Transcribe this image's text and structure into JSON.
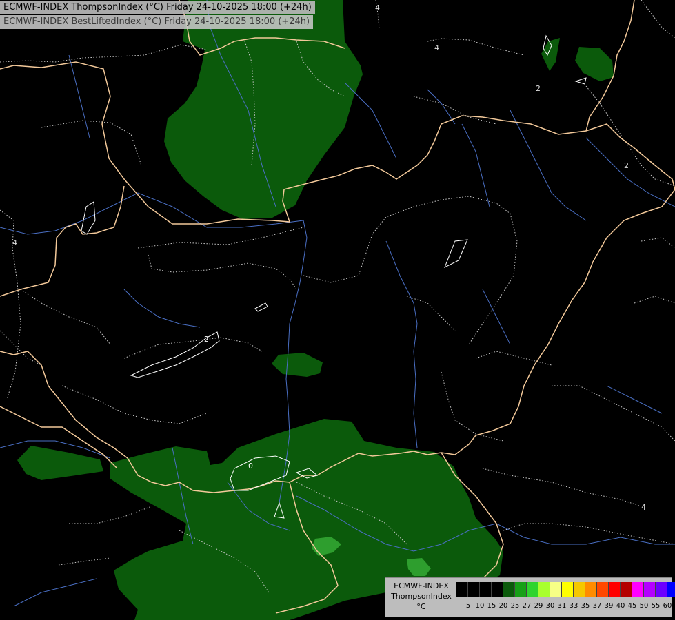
{
  "header": {
    "title_primary": "ECMWF-INDEX ThompsonIndex (°C) Friday 24-10-2025 18:00 (+24h)",
    "title_secondary": "ECMWF-INDEX BestLiftedIndex (°C) Friday 24-10-2025 18:00 (+24h)"
  },
  "map": {
    "contour_labels": [
      "4",
      "4",
      "2",
      "2",
      "4",
      "2",
      "0",
      "4"
    ],
    "colors": {
      "background": "#000000",
      "fill_low": "#0b5a0b",
      "fill_high": "#2e9e2e",
      "borders": "#f3c99a",
      "rivers": "#4a6fc4",
      "isolines": "#c8c8c8",
      "lifted_index_zero": "#ffffff"
    }
  },
  "legend": {
    "model": "ECMWF-INDEX",
    "parameter": "ThompsonIndex",
    "unit": "°C",
    "ticks": [
      "5",
      "10",
      "15",
      "20",
      "25",
      "27",
      "29",
      "30",
      "31",
      "33",
      "35",
      "37",
      "39",
      "40",
      "45",
      "50",
      "55",
      "60"
    ],
    "colors": [
      "#000000",
      "#000000",
      "#000000",
      "#000000",
      "#0b5a0b",
      "#17a017",
      "#2ed42e",
      "#a8ff2e",
      "#f7ff86",
      "#ffff00",
      "#f5c800",
      "#ff8c00",
      "#ff4800",
      "#ff0000",
      "#b40000",
      "#ff00ff",
      "#b400ff",
      "#6c00ff",
      "#0000ff"
    ]
  }
}
